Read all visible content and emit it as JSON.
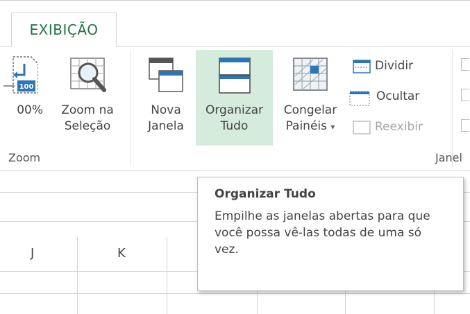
{
  "tabs": {
    "active_label": "EXIBIÇÃO"
  },
  "zoom_group": {
    "zoom100_label": "00%",
    "zoom_selection_label": "Zoom na Seleção",
    "zoom100_badge": "100",
    "group_label": "Zoom"
  },
  "window_group": {
    "new_window_label": "Nova Janela",
    "arrange_all_label": "Organizar Tudo",
    "freeze_panes_label": "Congelar Painéis",
    "freeze_dropdown": "▾",
    "split_label": "Dividir",
    "hide_label": "Ocultar",
    "unhide_label": "Reexibir",
    "group_label": "Janel"
  },
  "sheet": {
    "columns": [
      "J",
      "K"
    ]
  },
  "tooltip": {
    "title": "Organizar Tudo",
    "body": "Empilhe as janelas abertas para que você possa vê-las todas de uma só vez."
  },
  "colors": {
    "accent": "#217346",
    "hover": "#d5ecdd",
    "icon_blue": "#2e75b6"
  }
}
